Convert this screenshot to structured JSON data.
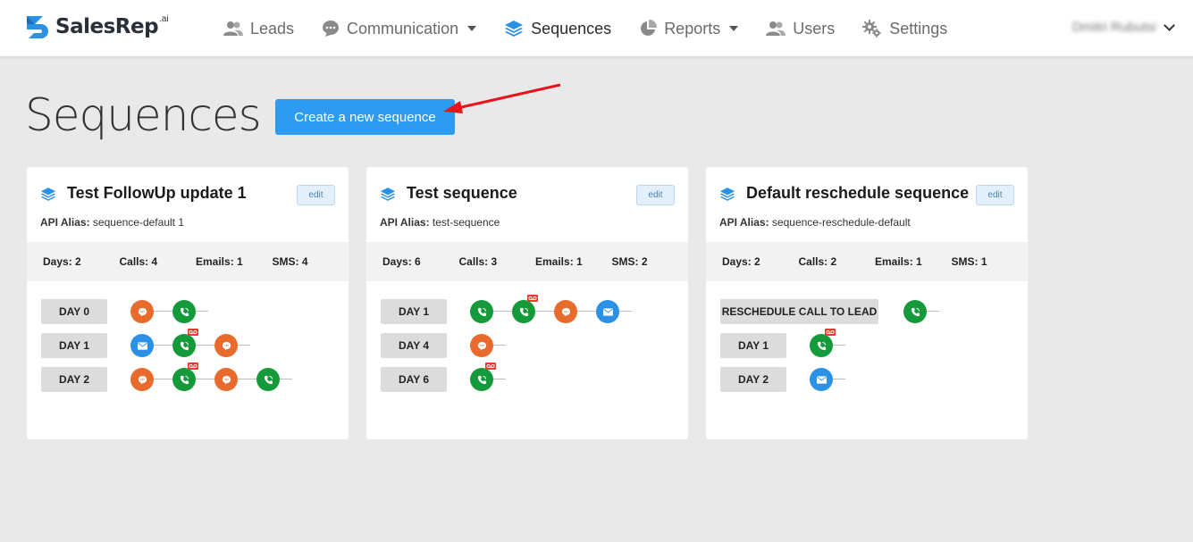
{
  "brand": {
    "name": "SalesRep",
    "suffix": ".ai"
  },
  "nav": {
    "items": [
      {
        "label": "Leads",
        "icon": "users-icon"
      },
      {
        "label": "Communication",
        "icon": "chat-icon",
        "dropdown": true
      },
      {
        "label": "Sequences",
        "icon": "layers-icon",
        "active": true
      },
      {
        "label": "Reports",
        "icon": "pie-chart-icon",
        "dropdown": true
      },
      {
        "label": "Users",
        "icon": "users-icon"
      },
      {
        "label": "Settings",
        "icon": "gear-icon"
      }
    ],
    "user_name": "Dmitri Rubutsi"
  },
  "page": {
    "title": "Sequences",
    "create_button": "Create a new sequence"
  },
  "colors": {
    "call": "#159a3b",
    "sms": "#e86a2c",
    "email": "#2b91e6",
    "voicemail": "#e53b2f",
    "primary": "#2d9cf0",
    "arrow": "#e8141b"
  },
  "cards": [
    {
      "title": "Test FollowUp update 1",
      "edit_label": "edit",
      "alias_label": "API Alias:",
      "alias_value": "sequence-default 1",
      "stats": {
        "days": "Days: 2",
        "calls": "Calls: 4",
        "emails": "Emails: 1",
        "sms": "SMS: 4"
      },
      "days": [
        {
          "label": "DAY 0",
          "steps": [
            "sms",
            "call"
          ]
        },
        {
          "label": "DAY 1",
          "steps": [
            "email",
            "call-vm",
            "sms"
          ]
        },
        {
          "label": "DAY 2",
          "steps": [
            "sms",
            "call-vm",
            "sms",
            "call"
          ]
        }
      ]
    },
    {
      "title": "Test sequence",
      "edit_label": "edit",
      "alias_label": "API Alias:",
      "alias_value": "test-sequence",
      "stats": {
        "days": "Days: 6",
        "calls": "Calls: 3",
        "emails": "Emails: 1",
        "sms": "SMS: 2"
      },
      "days": [
        {
          "label": "DAY 1",
          "steps": [
            "call",
            "call-vm",
            "sms",
            "email"
          ]
        },
        {
          "label": "DAY 4",
          "steps": [
            "sms"
          ]
        },
        {
          "label": "DAY 6",
          "steps": [
            "call-vm"
          ]
        }
      ]
    },
    {
      "title": "Default reschedule sequence",
      "edit_label": "edit",
      "alias_label": "API Alias:",
      "alias_value": "sequence-reschedule-default",
      "stats": {
        "days": "Days: 2",
        "calls": "Calls: 2",
        "emails": "Emails: 1",
        "sms": "SMS: 1"
      },
      "days": [
        {
          "label": "RESCHEDULE CALL TO LEAD",
          "wide": true,
          "steps": [
            "call"
          ]
        },
        {
          "label": "DAY 1",
          "steps": [
            "call-vm"
          ]
        },
        {
          "label": "DAY 2",
          "steps": [
            "email"
          ]
        }
      ]
    }
  ]
}
